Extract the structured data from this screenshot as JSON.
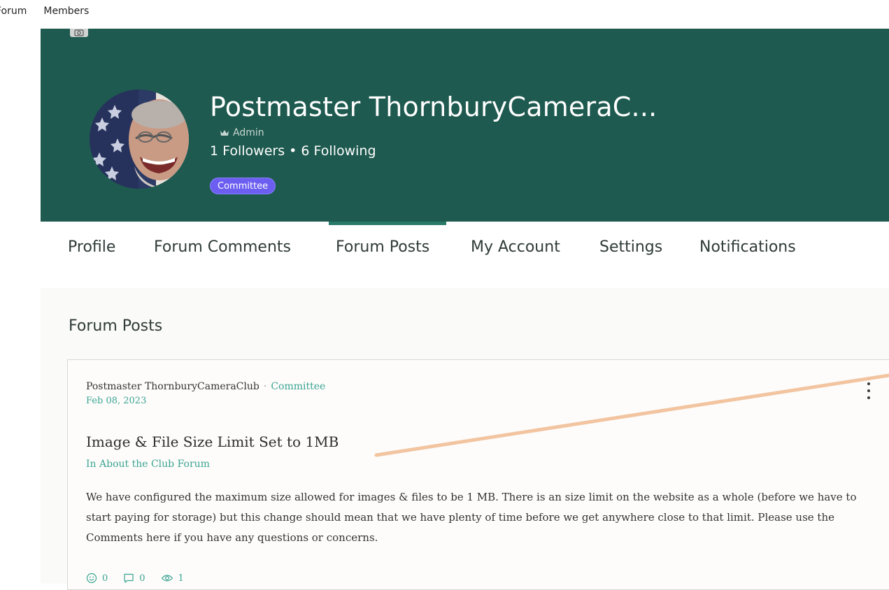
{
  "site_nav": {
    "items": [
      "Forum",
      "Members"
    ]
  },
  "profile": {
    "name": "Postmaster ThornburyCameraC...",
    "role": "Admin",
    "follow_stats": "1 Followers • 6 Following",
    "badge": "Committee"
  },
  "tabs": [
    {
      "label": "Profile",
      "active": false
    },
    {
      "label": "Forum Comments",
      "active": false
    },
    {
      "label": "Forum Posts",
      "active": true
    },
    {
      "label": "My Account",
      "active": false
    },
    {
      "label": "Settings",
      "active": false
    },
    {
      "label": "Notifications",
      "active": false
    }
  ],
  "section": {
    "title": "Forum Posts"
  },
  "post": {
    "author": "Postmaster ThornburyCameraClub",
    "separator": "·",
    "author_role": "Committee",
    "date": "Feb 08, 2023",
    "title": "Image & File Size Limit Set to 1MB",
    "forum": "In About the Club Forum",
    "body": "We have configured the maximum size allowed for images & files to be 1 MB. There is an size limit on the website as a whole (before we have to start paying for storage) but this change should mean that we have plenty of time before we get anywhere close to that limit. Please use the Comments here if you have any questions or concerns.",
    "likes": "0",
    "comments": "0",
    "views": "1"
  },
  "colors": {
    "banner": "#1e5a4f",
    "accent": "#3aa392",
    "badge": "#6b5ef0",
    "annotation_line": "#f2c4a0"
  },
  "icons": [
    "camera-icon",
    "crown-icon",
    "kebab-menu-icon",
    "smiley-icon",
    "comment-icon",
    "eye-icon"
  ]
}
